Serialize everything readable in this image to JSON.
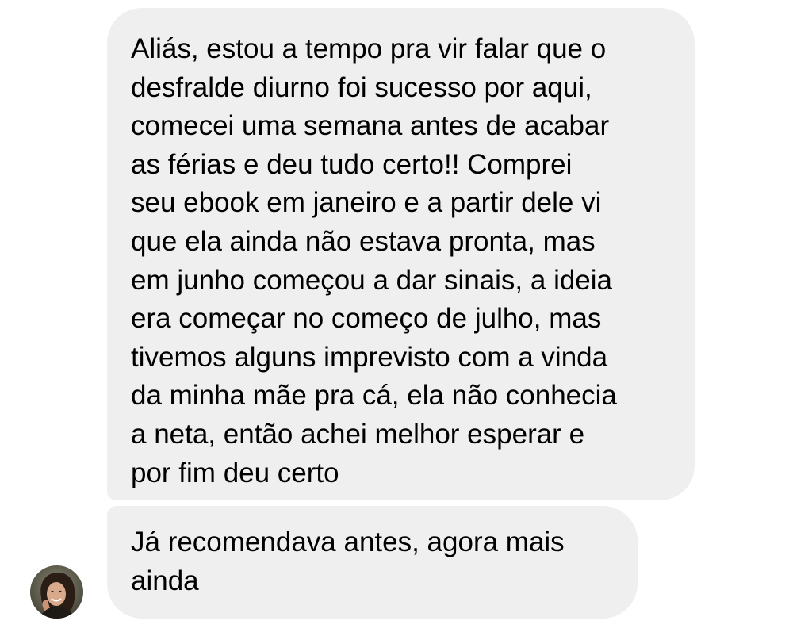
{
  "thread": {
    "messages": [
      {
        "lines": [
          "Aliás, estou a tempo pra vir falar que o",
          "desfralde diurno foi sucesso por aqui,",
          "comecei uma semana antes de acabar",
          "as férias e deu tudo certo!! Comprei",
          "seu ebook em janeiro e a partir dele vi",
          "que ela ainda não estava pronta, mas",
          "em junho começou a dar sinais, a ideia",
          "era começar no começo de julho, mas",
          "tivemos alguns imprevisto com a vinda",
          "da minha mãe pra cá, ela não conhecia",
          "a neta, então achei melhor esperar e",
          "por fim deu certo"
        ]
      },
      {
        "lines": [
          "Já recomendava antes, agora mais",
          "ainda"
        ]
      }
    ]
  },
  "colors": {
    "bubble_background": "#efefef",
    "text": "#000000",
    "page_background": "#ffffff"
  },
  "icons": {
    "avatar": "sender-avatar-photo"
  }
}
